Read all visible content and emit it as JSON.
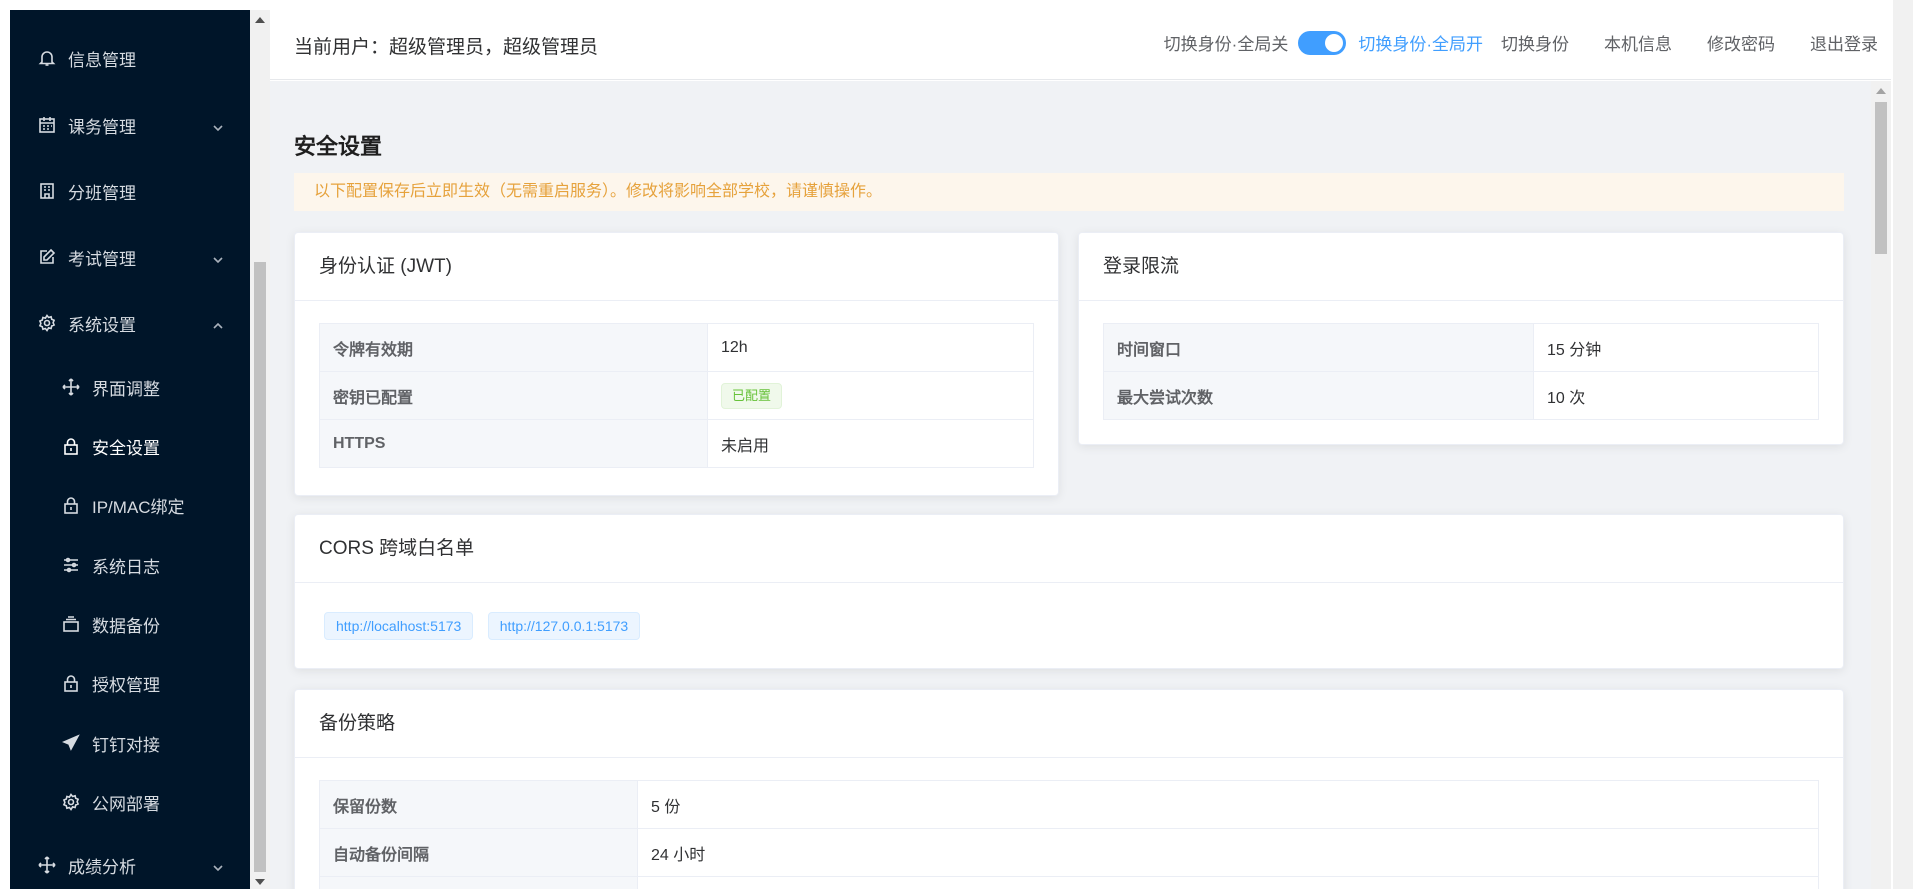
{
  "sidebar": {
    "items": [
      {
        "label": "信息管理",
        "icon": "bell-icon"
      },
      {
        "label": "课务管理",
        "icon": "calendar-icon"
      },
      {
        "label": "分班管理",
        "icon": "building-icon"
      },
      {
        "label": "考试管理",
        "icon": "edit-icon"
      },
      {
        "label": "系统设置",
        "icon": "gear-icon"
      },
      {
        "label": "界面调整",
        "icon": "move-icon"
      },
      {
        "label": "安全设置",
        "icon": "lock-icon"
      },
      {
        "label": "IP/MAC绑定",
        "icon": "lock-icon"
      },
      {
        "label": "系统日志",
        "icon": "sliders-icon"
      },
      {
        "label": "数据备份",
        "icon": "box-icon"
      },
      {
        "label": "授权管理",
        "icon": "lock-icon"
      },
      {
        "label": "钉钉对接",
        "icon": "send-icon"
      },
      {
        "label": "公网部署",
        "icon": "gear-icon"
      },
      {
        "label": "成绩分析",
        "icon": "move-icon"
      }
    ]
  },
  "header": {
    "user_text": "当前用户：超级管理员，超级管理员",
    "switch_off_label": "切换身份·全局关",
    "switch_on_label": "切换身份·全局开",
    "switch_on": true,
    "links": [
      "切换身份",
      "本机信息",
      "修改密码",
      "退出登录"
    ]
  },
  "main": {
    "title": "安全设置",
    "alert": "以下配置保存后立即生效（无需重启服务）。修改将影响全部学校，请谨慎操作。",
    "jwt": {
      "title": "身份认证 (JWT)",
      "rows": [
        {
          "key": "令牌有效期",
          "value": "12h"
        },
        {
          "key": "密钥已配置",
          "value": "已配置"
        },
        {
          "key": "HTTPS",
          "value": "未启用"
        }
      ]
    },
    "rate": {
      "title": "登录限流",
      "rows": [
        {
          "key": "时间窗口",
          "value": "15 分钟"
        },
        {
          "key": "最大尝试次数",
          "value": "10 次"
        }
      ]
    },
    "cors": {
      "title": "CORS 跨域白名单",
      "origins": [
        "http://localhost:5173",
        "http://127.0.0.1:5173"
      ]
    },
    "backup": {
      "title": "备份策略",
      "rows": [
        {
          "key": "保留份数",
          "value": "5 份"
        },
        {
          "key": "自动备份间隔",
          "value": "24 小时"
        }
      ]
    }
  },
  "colors": {
    "sidebar_bg": "#001529",
    "accent": "#409eff",
    "warning_text": "#e6a23c",
    "warning_bg": "#fdf6ec",
    "success": "#67c23a"
  }
}
